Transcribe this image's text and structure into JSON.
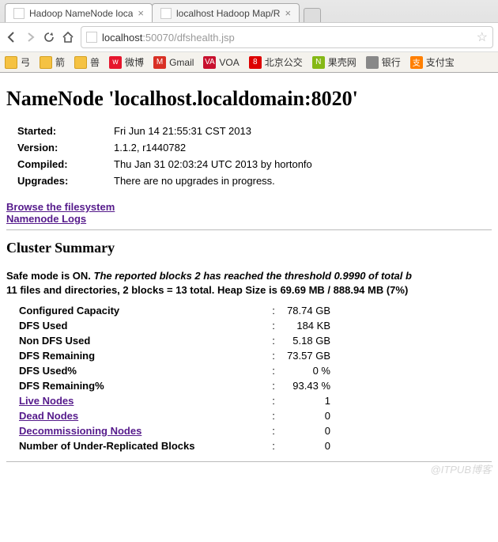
{
  "browser": {
    "tabs": [
      {
        "title": "Hadoop NameNode loca"
      },
      {
        "title": "localhost Hadoop Map/R"
      }
    ],
    "url": {
      "host": "localhost",
      "port": ":50070",
      "path": "/dfshealth.jsp"
    },
    "bookmarks": [
      {
        "label": "弓",
        "color": "#f5c242"
      },
      {
        "label": "箭",
        "color": "#f5c242"
      },
      {
        "label": "兽",
        "color": "#f5c242"
      },
      {
        "label": "微博",
        "icon": "w",
        "color": "#e6162d"
      },
      {
        "label": "Gmail",
        "icon": "M",
        "color": "#d93025"
      },
      {
        "label": "VOA",
        "icon": "VA",
        "color": "#c8102e"
      },
      {
        "label": "北京公交",
        "icon": "8",
        "color": "#d00"
      },
      {
        "label": "果壳网",
        "icon": "N",
        "color": "#85b816"
      },
      {
        "label": "银行",
        "icon": "",
        "color": "#888"
      },
      {
        "label": "支付宝",
        "icon": "支",
        "color": "#ff7f00"
      }
    ]
  },
  "page": {
    "heading": "NameNode 'localhost.localdomain:8020'",
    "info": [
      {
        "label": "Started:",
        "value": "Fri Jun 14 21:55:31 CST 2013"
      },
      {
        "label": "Version:",
        "value": "1.1.2, r1440782"
      },
      {
        "label": "Compiled:",
        "value": "Thu Jan 31 02:03:24 UTC 2013 by hortonfo"
      },
      {
        "label": "Upgrades:",
        "value": "There are no upgrades in progress."
      }
    ],
    "links": {
      "browse": "Browse the filesystem",
      "logs": "Namenode Logs"
    },
    "cluster_heading": "Cluster Summary",
    "safe_mode_prefix": "Safe mode is ON. ",
    "safe_mode_italic": "The reported blocks 2 has reached the threshold 0.9990 of total b",
    "heap_line": "11 files and directories, 2 blocks = 13 total. Heap Size is 69.69 MB / 888.94 MB (7%) ",
    "rows": [
      {
        "label": "Configured Capacity",
        "value": "78.74 GB",
        "link": false
      },
      {
        "label": "DFS Used",
        "value": "184 KB",
        "link": false
      },
      {
        "label": "Non DFS Used",
        "value": "5.18 GB",
        "link": false
      },
      {
        "label": "DFS Remaining",
        "value": "73.57 GB",
        "link": false
      },
      {
        "label": "DFS Used%",
        "value": "0 %",
        "link": false
      },
      {
        "label": "DFS Remaining%",
        "value": "93.43 %",
        "link": false
      },
      {
        "label": "Live Nodes",
        "value": "1",
        "link": true
      },
      {
        "label": "Dead Nodes",
        "value": "0",
        "link": true
      },
      {
        "label": "Decommissioning Nodes",
        "value": "0",
        "link": true
      },
      {
        "label": "Number of Under-Replicated Blocks",
        "value": "0",
        "link": false
      }
    ],
    "watermark": "@ITPUB博客"
  }
}
